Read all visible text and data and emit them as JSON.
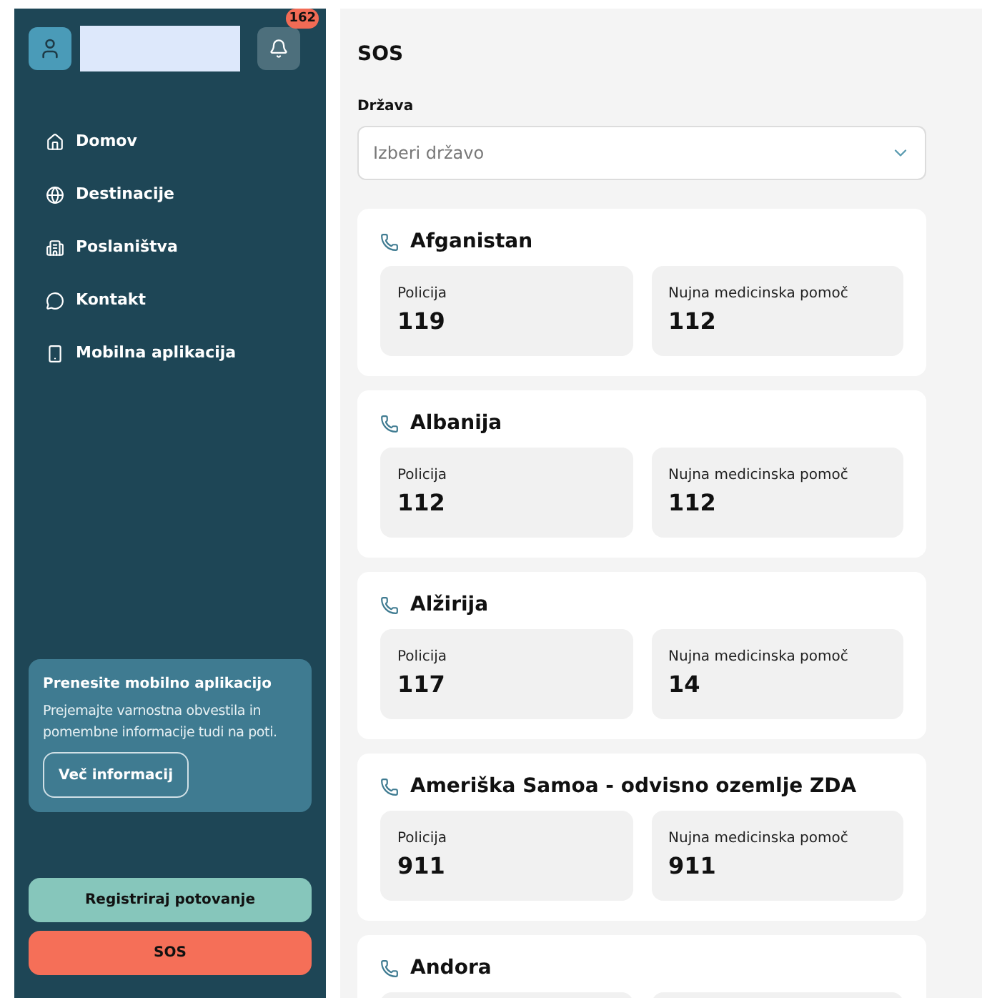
{
  "header": {
    "notification_count": "162"
  },
  "nav": [
    {
      "label": "Domov"
    },
    {
      "label": "Destinacije"
    },
    {
      "label": "Poslaništva"
    },
    {
      "label": "Kontakt"
    },
    {
      "label": "Mobilna aplikacija"
    }
  ],
  "promo": {
    "title": "Prenesite mobilno aplikacijo",
    "text": "Prejemajte varnostna obvestila in pomembne informacije tudi na poti.",
    "button": "Več informacij"
  },
  "actions": [
    {
      "label": "Registriraj potovanje",
      "kind": "secondary"
    },
    {
      "label": "SOS",
      "kind": "danger"
    }
  ],
  "page_title": "SOS",
  "country_select": {
    "label": "Država",
    "placeholder": "Izberi državo"
  },
  "countries": [
    {
      "name": "Afganistan",
      "numbers": [
        {
          "label": "Policija",
          "value": "119"
        },
        {
          "label": "Nujna medicinska pomoč",
          "value": "112"
        }
      ]
    },
    {
      "name": "Albanija",
      "numbers": [
        {
          "label": "Policija",
          "value": "112"
        },
        {
          "label": "Nujna medicinska pomoč",
          "value": "112"
        }
      ]
    },
    {
      "name": "Alžirija",
      "numbers": [
        {
          "label": "Policija",
          "value": "117"
        },
        {
          "label": "Nujna medicinska pomoč",
          "value": "14"
        }
      ]
    },
    {
      "name": "Ameriška Samoa - odvisno ozemlje ZDA",
      "numbers": [
        {
          "label": "Policija",
          "value": "911"
        },
        {
          "label": "Nujna medicinska pomoč",
          "value": "911"
        }
      ]
    },
    {
      "name": "Andora"
    }
  ]
}
